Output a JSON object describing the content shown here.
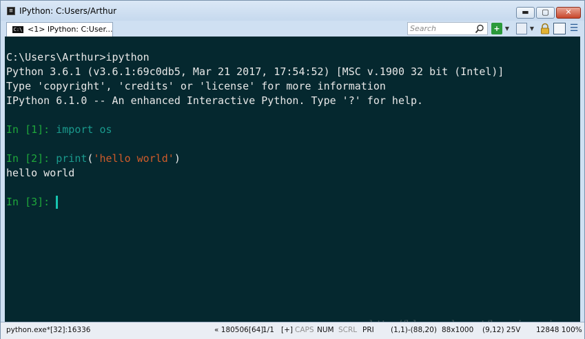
{
  "window": {
    "title": "IPython: C:Users/Arthur",
    "buttons": {
      "minimize": "▬",
      "maximize": "▢",
      "close": "✕"
    }
  },
  "tabs": [
    {
      "label": "<1> IPython: C:User..."
    }
  ],
  "search": {
    "placeholder": "Search"
  },
  "console": {
    "lines": [
      {
        "text": "C:\\Users\\Arthur>ipython"
      },
      {
        "text": "Python 3.6.1 (v3.6.1:69c0db5, Mar 21 2017, 17:54:52) [MSC v.1900 32 bit (Intel)]"
      },
      {
        "text": "Type 'copyright', 'credits' or 'license' for more information"
      },
      {
        "text": "IPython 6.1.0 -- An enhanced Interactive Python. Type '?' for help."
      }
    ],
    "prompts": [
      {
        "in_label": "In [",
        "num": "1",
        "close": "]: ",
        "code_kw": "import os"
      },
      {
        "in_label": "In [",
        "num": "2",
        "close": "]: ",
        "code_fn": "print",
        "paren_open": "(",
        "code_str": "'hello world'",
        "paren_close": ")",
        "output": "hello world"
      },
      {
        "in_label": "In [",
        "num": "3",
        "close": "]: "
      }
    ],
    "colors": {
      "background": "#05282f",
      "prompt_green": "#1fa83b",
      "keyword_teal": "#1a9a8d",
      "string_orange": "#cf5b2a"
    }
  },
  "status": {
    "process": "python.exe*[32]:16336",
    "position": "« 180506[64]",
    "page": "1/1",
    "plus": "[+]",
    "caps": "CAPS",
    "num": "NUM",
    "scrl": "SCRL",
    "pri": "PRI",
    "sel": "(1,1)-(88,20)",
    "size": "88x1000",
    "cursor": "(9,12) 25V",
    "zoom": "12848 100%"
  },
  "watermark": "http://blog.csdn.net/huaxin_gzj"
}
